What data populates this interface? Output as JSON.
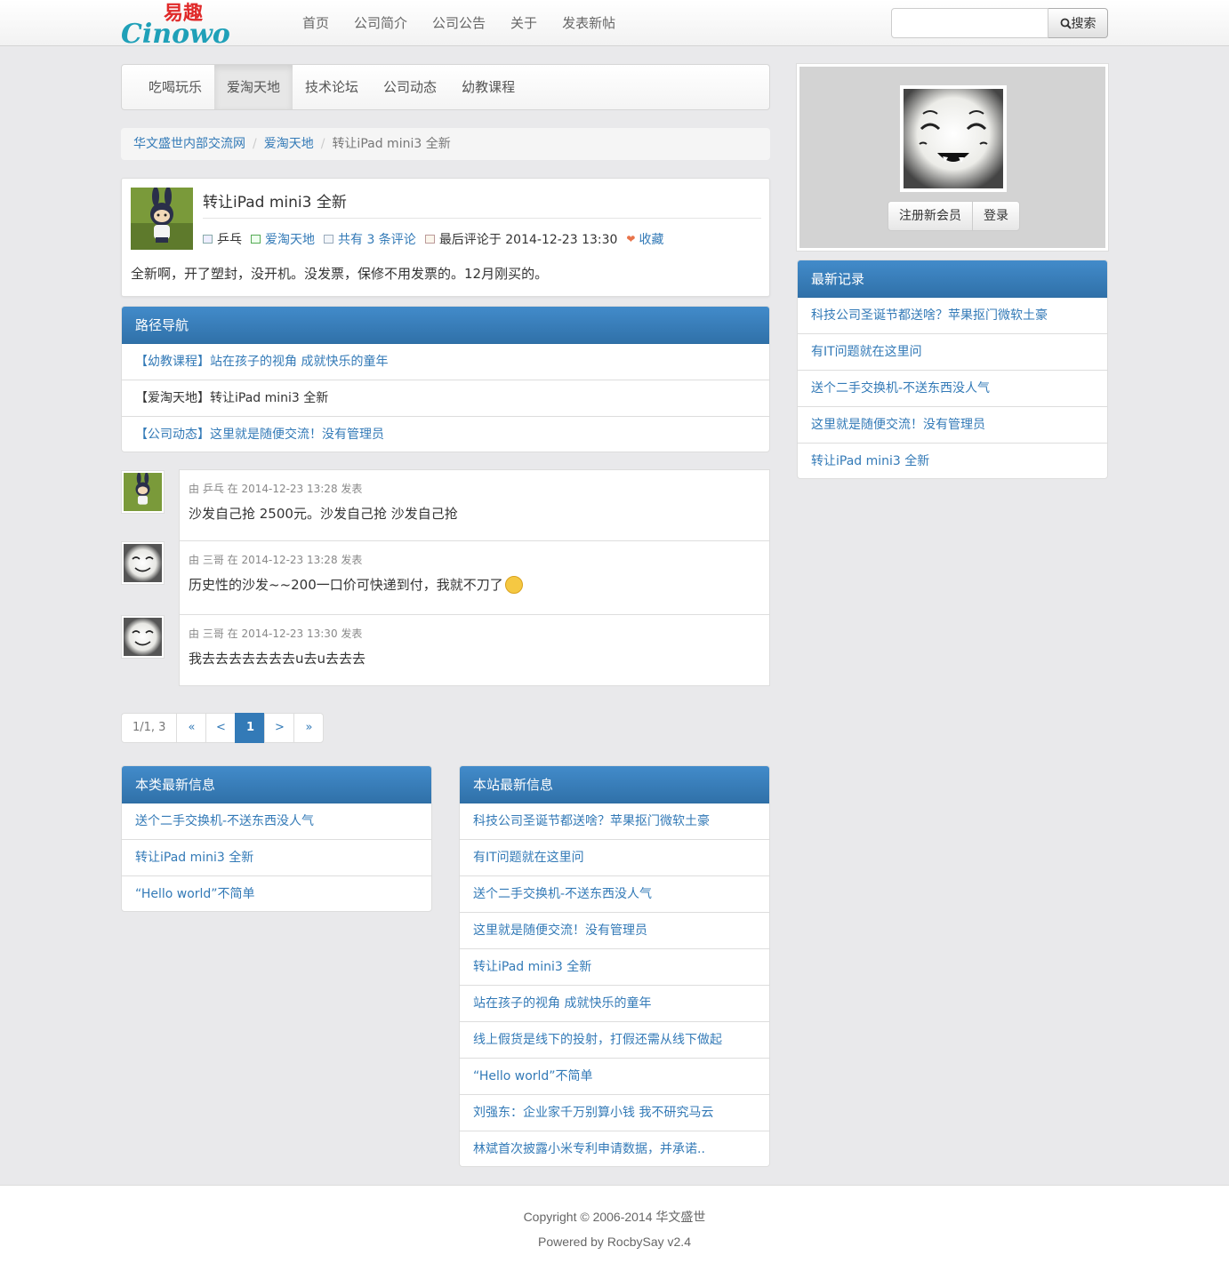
{
  "brand": {
    "logo_text_cn": "易趣",
    "logo_text_en": "Cinowo"
  },
  "topnav": [
    "首页",
    "公司简介",
    "公司公告",
    "关于",
    "发表新帖"
  ],
  "search": {
    "placeholder": "",
    "button": "搜索"
  },
  "subnav": {
    "items": [
      "吃喝玩乐",
      "爱淘天地",
      "技术论坛",
      "公司动态",
      "幼教课程"
    ],
    "active": "爱淘天地"
  },
  "breadcrumb": [
    "华文盛世内部交流网",
    "爱淘天地",
    "转让iPad mini3 全新"
  ],
  "post": {
    "title": "转让iPad mini3 全新",
    "author": "乒乓",
    "category": "爱淘天地",
    "comments": "共有 3 条评论",
    "last_comment": "最后评论于 2014-12-23 13:30",
    "favorite": "收藏",
    "body": "全新啊，开了塑封，没开机。没发票，保修不用发票的。12月刚买的。"
  },
  "path_nav": {
    "title": "路径导航",
    "items": [
      {
        "label": "【幼教课程】站在孩子的视角 成就快乐的童年",
        "link": true
      },
      {
        "label": "【爱淘天地】转让iPad mini3 全新",
        "link": false
      },
      {
        "label": "【公司动态】这里就是随便交流！没有管理员",
        "link": true
      }
    ]
  },
  "comments": [
    {
      "by": "由 乒乓 在 2014-12-23 13:28 发表",
      "text": "沙发自己抢 2500元。沙发自己抢 沙发自己抢"
    },
    {
      "by": "由 三哥 在 2014-12-23 13:28 发表",
      "text": "历史性的沙发~~200一口价可快递到付，我就不刀了"
    },
    {
      "by": "由 三哥 在 2014-12-23 13:30 发表",
      "text": "我去去去去去去去u去u去去去"
    }
  ],
  "pager": {
    "info": "1/1, 3",
    "first": "«",
    "prev": "<",
    "current": "1",
    "next": ">",
    "last": "»"
  },
  "category_latest": {
    "title": "本类最新信息",
    "items": [
      "送个二手交换机-不送东西没人气",
      "转让iPad mini3 全新",
      "“Hello world”不简单"
    ]
  },
  "site_latest": {
    "title": "本站最新信息",
    "items": [
      "科技公司圣诞节都送啥？苹果抠门微软土豪",
      "有IT问题就在这里问",
      "送个二手交换机-不送东西没人气",
      "这里就是随便交流！没有管理员",
      "转让iPad mini3 全新",
      "站在孩子的视角 成就快乐的童年",
      "线上假货是线下的投射，打假还需从线下做起",
      "“Hello world”不简单",
      "刘强东：企业家千万别算小钱 我不研究马云",
      "林斌首次披露小米专利申请数据，并承诺.."
    ]
  },
  "member": {
    "register": "注册新会员",
    "login": "登录"
  },
  "recent": {
    "title": "最新记录",
    "items": [
      "科技公司圣诞节都送啥？苹果抠门微软土豪",
      "有IT问题就在这里问",
      "送个二手交换机-不送东西没人气",
      "这里就是随便交流！没有管理员",
      "转让iPad mini3 全新"
    ]
  },
  "footer": {
    "copyright": "Copyright © 2006-2014 华文盛世",
    "powered": "Powered by RocbySay v2.4"
  },
  "colors": {
    "accent": "#337ab7",
    "panel_header": "#3a80c0",
    "page_bg": "#e9e9eb"
  }
}
